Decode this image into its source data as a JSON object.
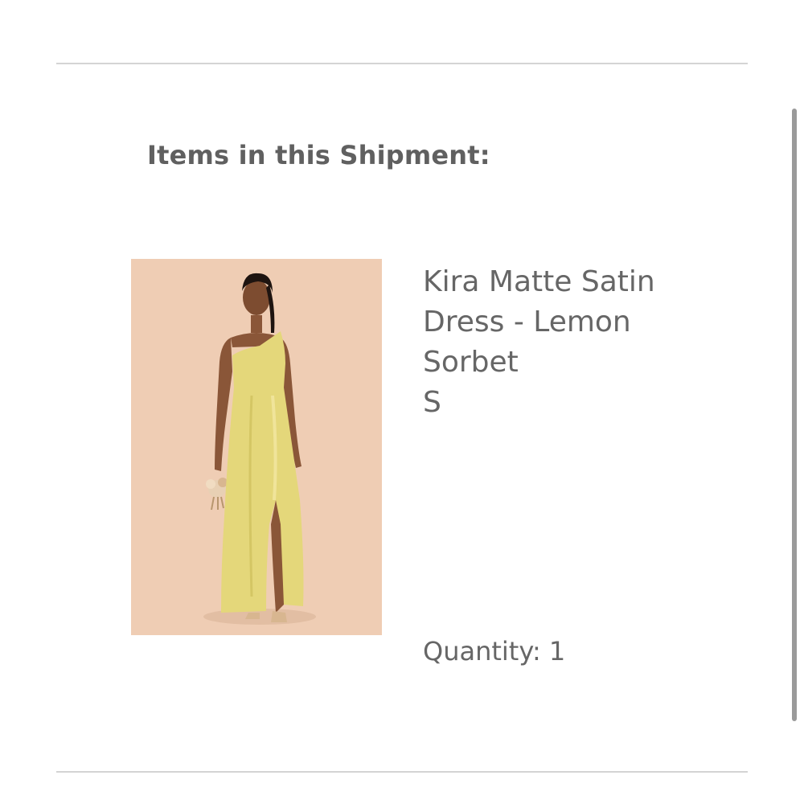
{
  "shipment": {
    "heading": "Items in this Shipment:"
  },
  "item": {
    "name": "Kira Matte Satin Dress - Lemon Sorbet",
    "size": "S",
    "quantity_text": "Quantity: 1",
    "image_alt": "Model wearing Kira Matte Satin Dress in Lemon Sorbet"
  },
  "colors": {
    "background": "#ffffff",
    "divider": "#d4d4d4",
    "heading_text": "#606060",
    "body_text": "#666666",
    "photo_backdrop": "#efcdb4",
    "dress": "#e4d77a",
    "scrollbar": "#9a9a9a"
  }
}
